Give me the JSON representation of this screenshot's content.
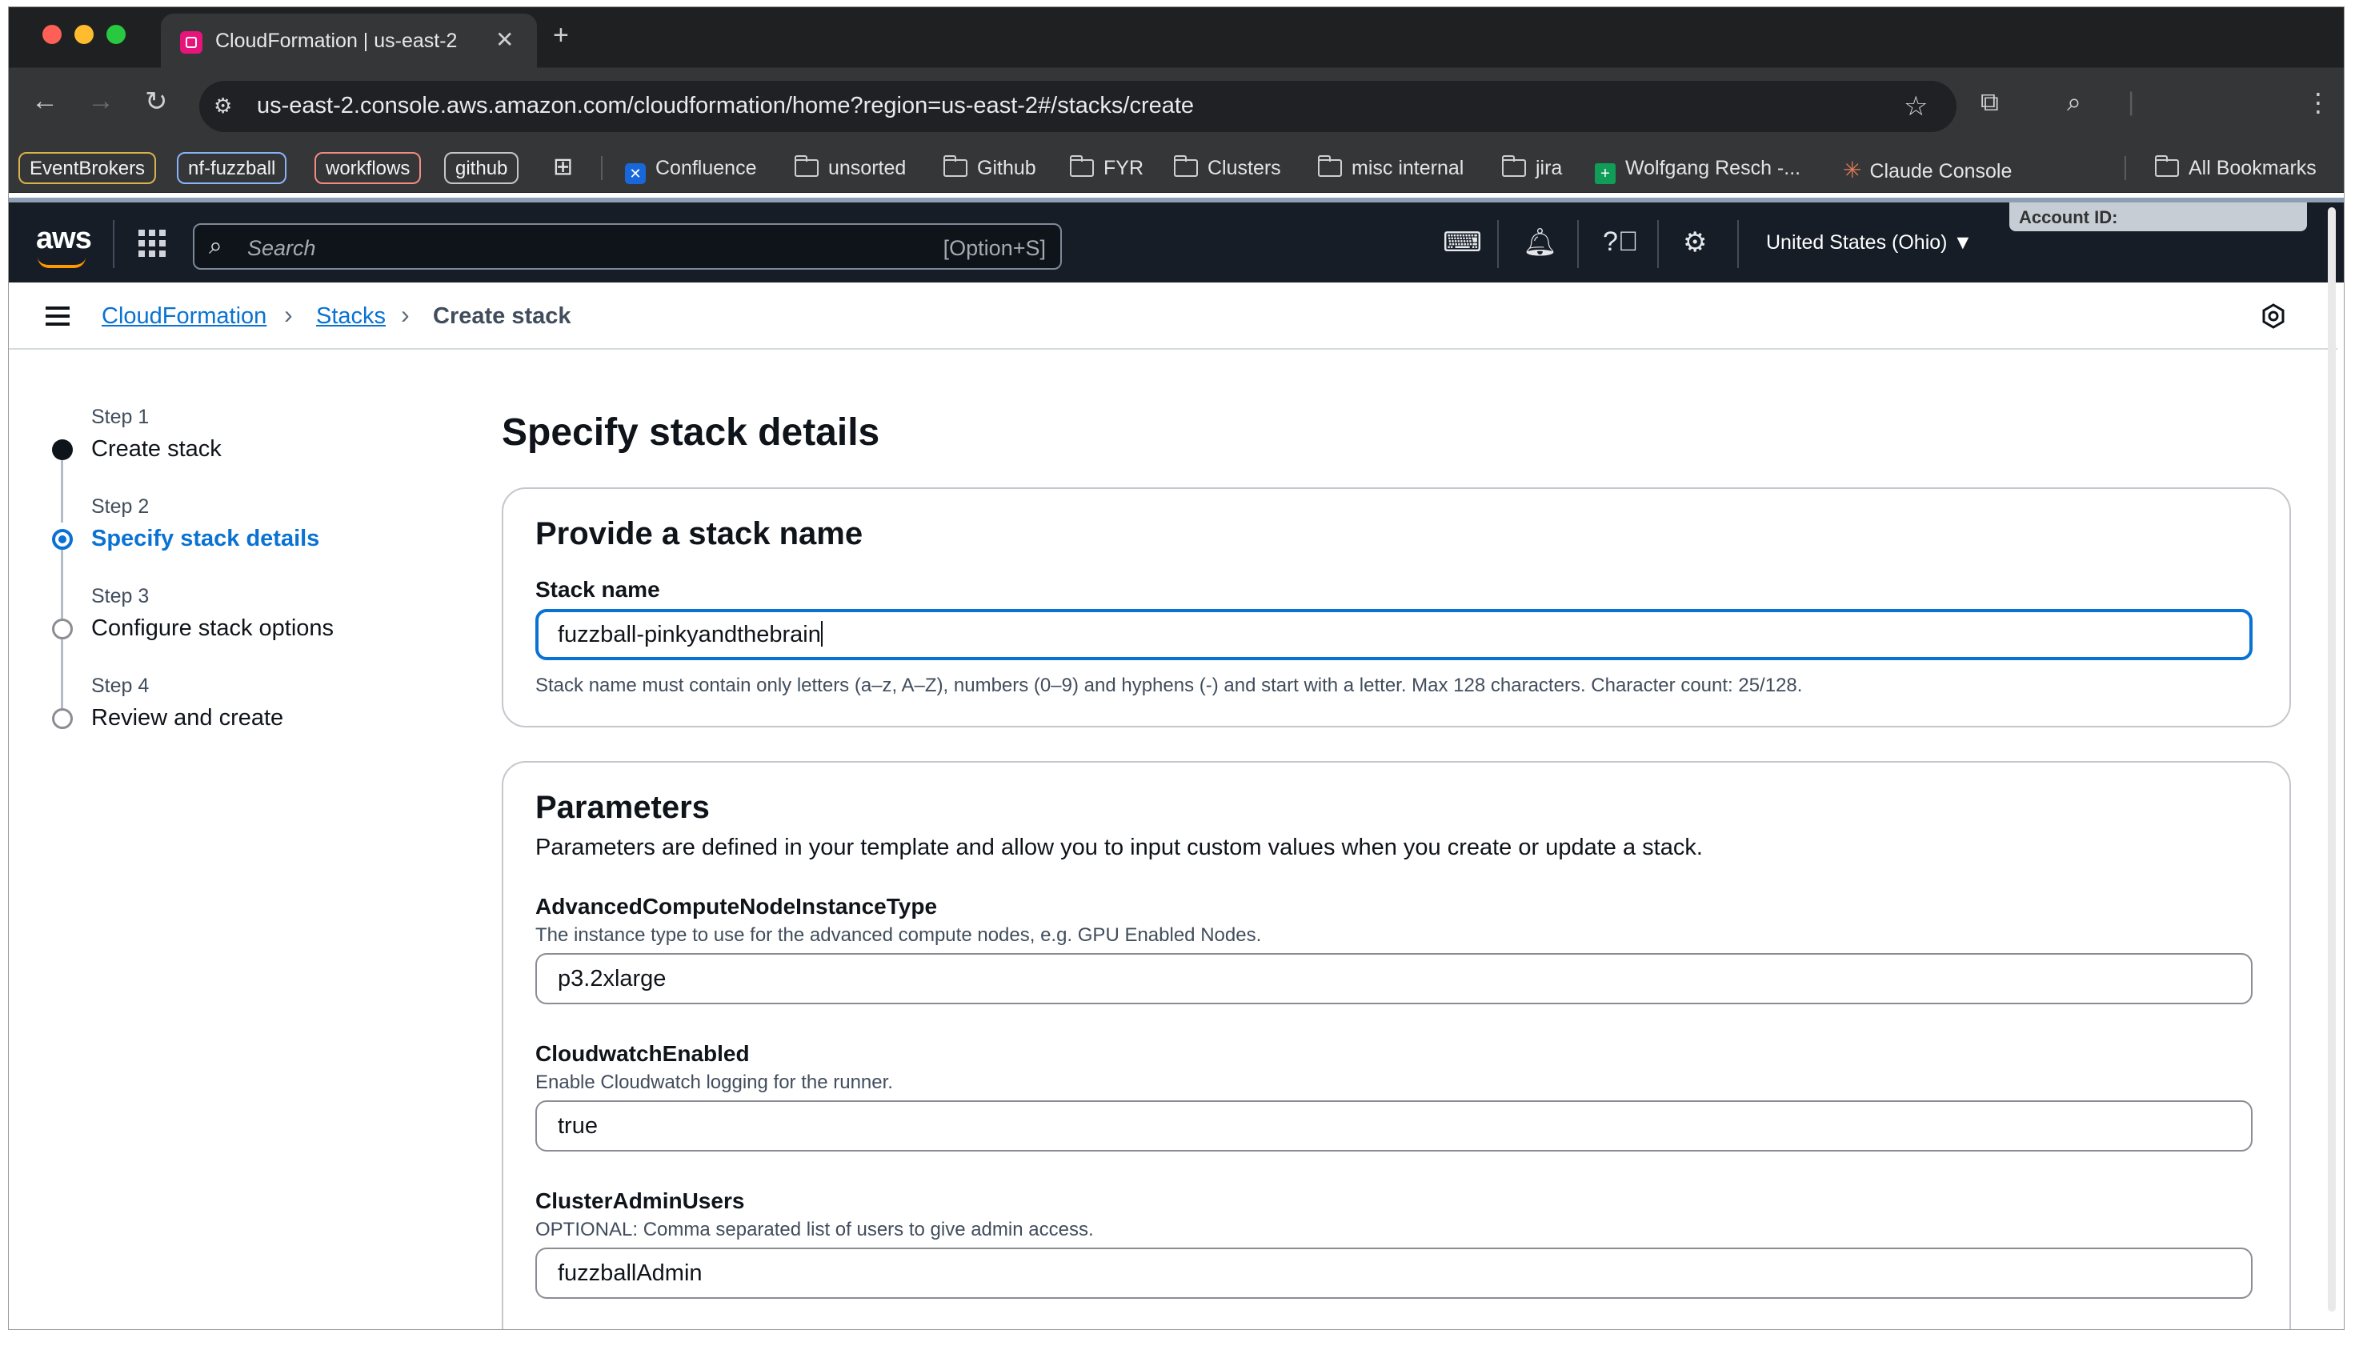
{
  "browser": {
    "tab_title": "CloudFormation | us-east-2",
    "url": "us-east-2.console.aws.amazon.com/cloudformation/home?region=us-east-2#/stacks/create",
    "bookmarks": {
      "chips": [
        "EventBrokers",
        "nf-fuzzball",
        "workflows",
        "github"
      ],
      "confluence": "Confluence",
      "unsorted": "unsorted",
      "github_folder": "Github",
      "fyr": "FYR",
      "clusters": "Clusters",
      "misc": "misc internal",
      "jira": "jira",
      "wolfgang": "Wolfgang Resch -...",
      "claude": "Claude Console",
      "all": "All Bookmarks"
    },
    "colors": {
      "chip_eventbrokers": "#d9b24a",
      "chip_nffuzzball": "#8ab4f8",
      "chip_workflows": "#f28b82",
      "chip_github": "#c4c7c5"
    }
  },
  "aws_header": {
    "logo": "aws",
    "search_placeholder": "Search",
    "search_shortcut": "[Option+S]",
    "region": "United States (Ohio)",
    "account_label": "Account ID:"
  },
  "breadcrumb": {
    "items": [
      "CloudFormation",
      "Stacks",
      "Create stack"
    ]
  },
  "steps": [
    {
      "label": "Step 1",
      "title": "Create stack",
      "state": "done"
    },
    {
      "label": "Step 2",
      "title": "Specify stack details",
      "state": "active"
    },
    {
      "label": "Step 3",
      "title": "Configure stack options",
      "state": "todo"
    },
    {
      "label": "Step 4",
      "title": "Review and create",
      "state": "todo"
    }
  ],
  "main": {
    "page_title": "Specify stack details",
    "stack_name_section": {
      "title": "Provide a stack name",
      "label": "Stack name",
      "value": "fuzzball-pinkyandthebrain",
      "hint": "Stack name must contain only letters (a–z, A–Z), numbers (0–9) and hyphens (-) and start with a letter. Max 128 characters. Character count: 25/128."
    },
    "parameters_section": {
      "title": "Parameters",
      "description": "Parameters are defined in your template and allow you to input custom values when you create or update a stack.",
      "params": [
        {
          "name": "AdvancedComputeNodeInstanceType",
          "description": "The instance type to use for the advanced compute nodes, e.g. GPU Enabled Nodes.",
          "value": "p3.2xlarge"
        },
        {
          "name": "CloudwatchEnabled",
          "description": "Enable Cloudwatch logging for the runner.",
          "value": "true"
        },
        {
          "name": "ClusterAdminUsers",
          "description": "OPTIONAL: Comma separated list of users to give admin access.",
          "value": "fuzzballAdmin"
        }
      ]
    }
  }
}
